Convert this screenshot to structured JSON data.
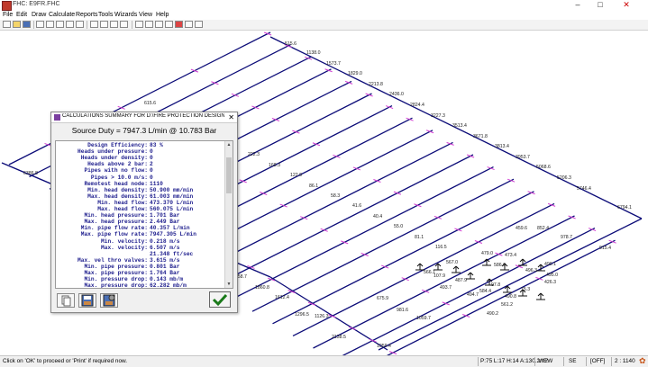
{
  "window": {
    "title": "FHC: E9FR.FHC"
  },
  "menu": [
    "File",
    "Edit",
    "Draw",
    "Calculate",
    "Reports",
    "Tools",
    "Wizards",
    "View",
    "Help"
  ],
  "drawing": {
    "labels_top": [
      "515.6",
      "1138.0",
      "1573.7",
      "1829.0",
      "2213.8",
      "2436.0",
      "2824.4",
      "3227.3",
      "3513.4",
      "3671.8",
      "3813.4",
      "3953.7",
      "5068.6",
      "5206.3",
      "5746.4",
      "6794.1"
    ],
    "labels_mid": [
      "615.6",
      "222.3",
      "168.3",
      "122.9",
      "86.1",
      "58.3",
      "41.6",
      "40.4",
      "55.0",
      "81.1",
      "116.5",
      "459.6",
      "852.4",
      "978.7",
      "915.4"
    ],
    "labels_left": [
      "6386.8"
    ],
    "labels_bottom": [
      "2658.7",
      "1860.8",
      "1612.4",
      "1296.5",
      "1126.3",
      "2138.5",
      "1059.4",
      "1059.7",
      "981.6",
      "675.9"
    ],
    "labels_sprinkler": [
      "479.0",
      "473.4",
      "586.6",
      "496.3",
      "490.1",
      "495.0",
      "426.3",
      "75.3",
      "490.8",
      "561.2",
      "490.2",
      "567.0",
      "566.1",
      "487.9",
      "493.7",
      "494.7",
      "107.9",
      "97.8",
      "584.4"
    ]
  },
  "dialog": {
    "title": "CALCULATIONS SUMMARY FOR D:\\FIRE PROTECTION DESIGN\\VALEO\\...",
    "source_duty": "Source Duty =  7947.3 L/min @  10.783 Bar",
    "rows": [
      {
        "label": "Design Efficiency:",
        "value": "83 %"
      },
      {
        "label": "Heads under pressure:",
        "value": "0"
      },
      {
        "label": "Heads under density:",
        "value": "0"
      },
      {
        "label": "Heads above 2 bar:",
        "value": "2"
      },
      {
        "label": "Pipes with no flow:",
        "value": "0"
      },
      {
        "label": "Pipes > 10.0 m/s:",
        "value": "0"
      },
      {
        "label": "Remotest head node:",
        "value": "1110"
      },
      {
        "label": "Min. head density:",
        "value": "50.900 mm/min"
      },
      {
        "label": "Max. head density:",
        "value": "61.003 mm/min"
      },
      {
        "label": "Min. head flow:",
        "value": "473.370 L/min"
      },
      {
        "label": "Max. head flow:",
        "value": "560.075 L/min"
      },
      {
        "label": "Min. head pressure:",
        "value": "1.701 Bar"
      },
      {
        "label": "Max. head pressure:",
        "value": "2.449 Bar"
      },
      {
        "label": "Min. pipe flow rate:",
        "value": "40.357 L/min"
      },
      {
        "label": "Max. pipe flow rate:",
        "value": "7947.305 L/min"
      },
      {
        "label": "Min. velocity:",
        "value": "0.218 m/s"
      },
      {
        "label": "Max. velocity:",
        "value": "6.507 m/s"
      },
      {
        "label": "",
        "value": "21.348 ft/sec"
      },
      {
        "label": "Max. vel thro valves:",
        "value": "3.615 m/s"
      },
      {
        "label": "Min. pipe pressure:",
        "value": "0.801 Bar"
      },
      {
        "label": "Max. pipe pressure:",
        "value": "1.764 Bar"
      },
      {
        "label": "Min. pressure drop:",
        "value": "0.143 mb/m"
      },
      {
        "label": "Max. pressure drop:",
        "value": "62.282 mb/m"
      }
    ],
    "ok_label": "OK"
  },
  "status": {
    "message": "Click on 'OK' to proceed or 'Print' if required now.",
    "coords": "P:75 L:17 H:14 A:130.2m2",
    "mode": "VIEW",
    "direction": "SE",
    "snap": "[OFF]",
    "scale": "2 : 1140"
  },
  "colors": {
    "pipe": "#0c0c78",
    "node": "#d23fd2",
    "label": "#202020",
    "dialog_text": "#1c1c8c",
    "ok_check": "#1a7a1a"
  }
}
